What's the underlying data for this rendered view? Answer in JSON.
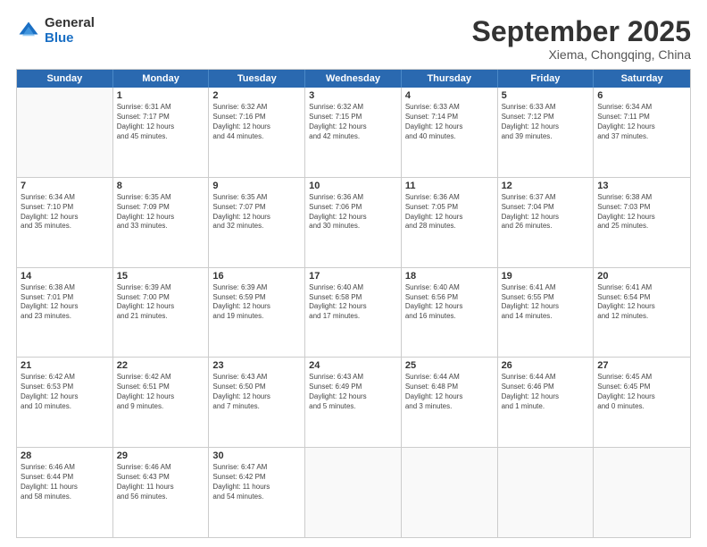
{
  "logo": {
    "general": "General",
    "blue": "Blue"
  },
  "title": "September 2025",
  "location": "Xiema, Chongqing, China",
  "days_of_week": [
    "Sunday",
    "Monday",
    "Tuesday",
    "Wednesday",
    "Thursday",
    "Friday",
    "Saturday"
  ],
  "weeks": [
    [
      {
        "day": "",
        "text": ""
      },
      {
        "day": "1",
        "text": "Sunrise: 6:31 AM\nSunset: 7:17 PM\nDaylight: 12 hours\nand 45 minutes."
      },
      {
        "day": "2",
        "text": "Sunrise: 6:32 AM\nSunset: 7:16 PM\nDaylight: 12 hours\nand 44 minutes."
      },
      {
        "day": "3",
        "text": "Sunrise: 6:32 AM\nSunset: 7:15 PM\nDaylight: 12 hours\nand 42 minutes."
      },
      {
        "day": "4",
        "text": "Sunrise: 6:33 AM\nSunset: 7:14 PM\nDaylight: 12 hours\nand 40 minutes."
      },
      {
        "day": "5",
        "text": "Sunrise: 6:33 AM\nSunset: 7:12 PM\nDaylight: 12 hours\nand 39 minutes."
      },
      {
        "day": "6",
        "text": "Sunrise: 6:34 AM\nSunset: 7:11 PM\nDaylight: 12 hours\nand 37 minutes."
      }
    ],
    [
      {
        "day": "7",
        "text": "Sunrise: 6:34 AM\nSunset: 7:10 PM\nDaylight: 12 hours\nand 35 minutes."
      },
      {
        "day": "8",
        "text": "Sunrise: 6:35 AM\nSunset: 7:09 PM\nDaylight: 12 hours\nand 33 minutes."
      },
      {
        "day": "9",
        "text": "Sunrise: 6:35 AM\nSunset: 7:07 PM\nDaylight: 12 hours\nand 32 minutes."
      },
      {
        "day": "10",
        "text": "Sunrise: 6:36 AM\nSunset: 7:06 PM\nDaylight: 12 hours\nand 30 minutes."
      },
      {
        "day": "11",
        "text": "Sunrise: 6:36 AM\nSunset: 7:05 PM\nDaylight: 12 hours\nand 28 minutes."
      },
      {
        "day": "12",
        "text": "Sunrise: 6:37 AM\nSunset: 7:04 PM\nDaylight: 12 hours\nand 26 minutes."
      },
      {
        "day": "13",
        "text": "Sunrise: 6:38 AM\nSunset: 7:03 PM\nDaylight: 12 hours\nand 25 minutes."
      }
    ],
    [
      {
        "day": "14",
        "text": "Sunrise: 6:38 AM\nSunset: 7:01 PM\nDaylight: 12 hours\nand 23 minutes."
      },
      {
        "day": "15",
        "text": "Sunrise: 6:39 AM\nSunset: 7:00 PM\nDaylight: 12 hours\nand 21 minutes."
      },
      {
        "day": "16",
        "text": "Sunrise: 6:39 AM\nSunset: 6:59 PM\nDaylight: 12 hours\nand 19 minutes."
      },
      {
        "day": "17",
        "text": "Sunrise: 6:40 AM\nSunset: 6:58 PM\nDaylight: 12 hours\nand 17 minutes."
      },
      {
        "day": "18",
        "text": "Sunrise: 6:40 AM\nSunset: 6:56 PM\nDaylight: 12 hours\nand 16 minutes."
      },
      {
        "day": "19",
        "text": "Sunrise: 6:41 AM\nSunset: 6:55 PM\nDaylight: 12 hours\nand 14 minutes."
      },
      {
        "day": "20",
        "text": "Sunrise: 6:41 AM\nSunset: 6:54 PM\nDaylight: 12 hours\nand 12 minutes."
      }
    ],
    [
      {
        "day": "21",
        "text": "Sunrise: 6:42 AM\nSunset: 6:53 PM\nDaylight: 12 hours\nand 10 minutes."
      },
      {
        "day": "22",
        "text": "Sunrise: 6:42 AM\nSunset: 6:51 PM\nDaylight: 12 hours\nand 9 minutes."
      },
      {
        "day": "23",
        "text": "Sunrise: 6:43 AM\nSunset: 6:50 PM\nDaylight: 12 hours\nand 7 minutes."
      },
      {
        "day": "24",
        "text": "Sunrise: 6:43 AM\nSunset: 6:49 PM\nDaylight: 12 hours\nand 5 minutes."
      },
      {
        "day": "25",
        "text": "Sunrise: 6:44 AM\nSunset: 6:48 PM\nDaylight: 12 hours\nand 3 minutes."
      },
      {
        "day": "26",
        "text": "Sunrise: 6:44 AM\nSunset: 6:46 PM\nDaylight: 12 hours\nand 1 minute."
      },
      {
        "day": "27",
        "text": "Sunrise: 6:45 AM\nSunset: 6:45 PM\nDaylight: 12 hours\nand 0 minutes."
      }
    ],
    [
      {
        "day": "28",
        "text": "Sunrise: 6:46 AM\nSunset: 6:44 PM\nDaylight: 11 hours\nand 58 minutes."
      },
      {
        "day": "29",
        "text": "Sunrise: 6:46 AM\nSunset: 6:43 PM\nDaylight: 11 hours\nand 56 minutes."
      },
      {
        "day": "30",
        "text": "Sunrise: 6:47 AM\nSunset: 6:42 PM\nDaylight: 11 hours\nand 54 minutes."
      },
      {
        "day": "",
        "text": ""
      },
      {
        "day": "",
        "text": ""
      },
      {
        "day": "",
        "text": ""
      },
      {
        "day": "",
        "text": ""
      }
    ]
  ]
}
